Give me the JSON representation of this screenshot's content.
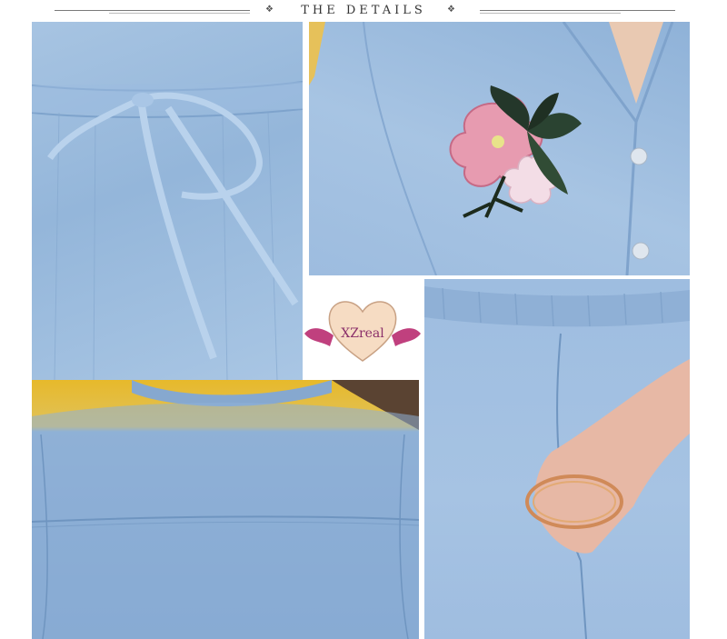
{
  "header": {
    "title": "THE DETAILS"
  },
  "logo": {
    "text": "XZreal"
  },
  "colors": {
    "denim": "#9dbcdf",
    "denim_dark": "#6f95c0",
    "heart": "#f6dcc3",
    "ribbon": "#c0407e"
  }
}
